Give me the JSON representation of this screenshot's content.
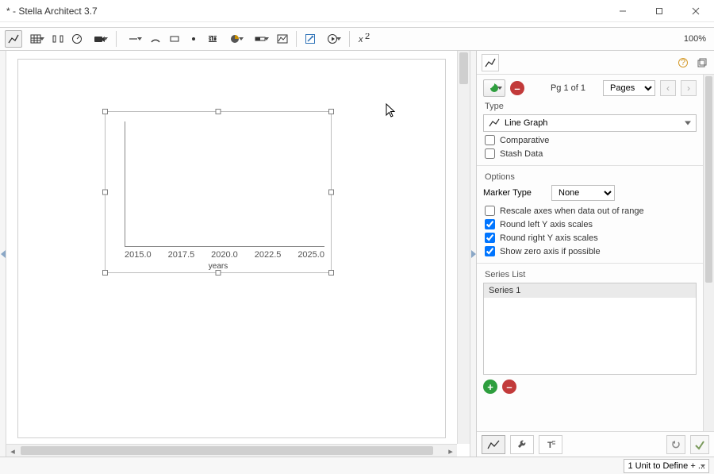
{
  "window": {
    "title": "* - Stella Architect 3.7"
  },
  "toolbar": {
    "zoom": "100%"
  },
  "canvas": {
    "xticks": [
      "2015.0",
      "2017.5",
      "2020.0",
      "2022.5",
      "2025.0"
    ],
    "xlabel": "years"
  },
  "panel": {
    "page_label": "Pg 1 of 1",
    "page_selector": "Pages",
    "type_section": "Type",
    "type_value": "Line Graph",
    "comparative": {
      "label": "Comparative",
      "checked": false
    },
    "stash": {
      "label": "Stash Data",
      "checked": false
    },
    "options_section": "Options",
    "marker_type_label": "Marker Type",
    "marker_type_value": "None",
    "rescale": {
      "label": "Rescale axes when data out of range",
      "checked": false
    },
    "round_left": {
      "label": "Round left Y axis scales",
      "checked": true
    },
    "round_right": {
      "label": "Round right Y axis scales",
      "checked": true
    },
    "show_zero": {
      "label": "Show zero axis if possible",
      "checked": true
    },
    "series_section": "Series List",
    "series_items": [
      "Series 1"
    ]
  },
  "status": {
    "units": "1 Unit to Define + ..."
  },
  "chart_data": {
    "type": "line",
    "title": "",
    "xlabel": "years",
    "ylabel": "",
    "xlim": [
      2015.0,
      2025.0
    ],
    "xticks": [
      2015.0,
      2017.5,
      2020.0,
      2022.5,
      2025.0
    ],
    "series": [
      {
        "name": "Series 1",
        "values": []
      }
    ]
  }
}
